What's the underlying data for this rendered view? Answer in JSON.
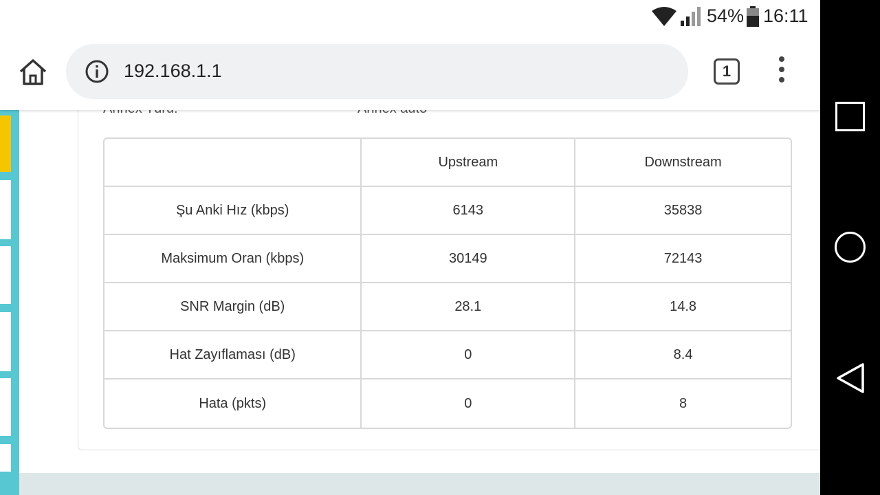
{
  "status_bar": {
    "battery_percent": "54%",
    "time": "16:11",
    "icons": [
      "wifi-icon",
      "cell-signal-icon",
      "battery-icon"
    ]
  },
  "browser": {
    "url": "192.168.1.1",
    "tab_count": "1",
    "icons": [
      "home-icon",
      "info-icon",
      "tabs-icon",
      "overflow-menu-icon"
    ]
  },
  "page": {
    "cut_off_label": "Annex Türü:",
    "cut_off_value": "Annex auto",
    "table": {
      "headers": [
        "",
        "Upstream",
        "Downstream"
      ],
      "rows": [
        {
          "label": "Şu Anki Hız (kbps)",
          "upstream": "6143",
          "downstream": "35838"
        },
        {
          "label": "Maksimum Oran (kbps)",
          "upstream": "30149",
          "downstream": "72143"
        },
        {
          "label": "SNR Margin (dB)",
          "upstream": "28.1",
          "downstream": "14.8"
        },
        {
          "label": "Hat Zayıflaması (dB)",
          "upstream": "0",
          "downstream": "8.4"
        },
        {
          "label": "Hata (pkts)",
          "upstream": "0",
          "downstream": "8"
        }
      ]
    }
  },
  "nav_bar": {
    "icons": [
      "recents-icon",
      "home-circle-icon",
      "back-icon"
    ]
  },
  "colors": {
    "rail": "#57c7d2",
    "rail_active": "#f5c500",
    "omnibox": "#f0f1f2",
    "border": "#d8d8d8"
  }
}
